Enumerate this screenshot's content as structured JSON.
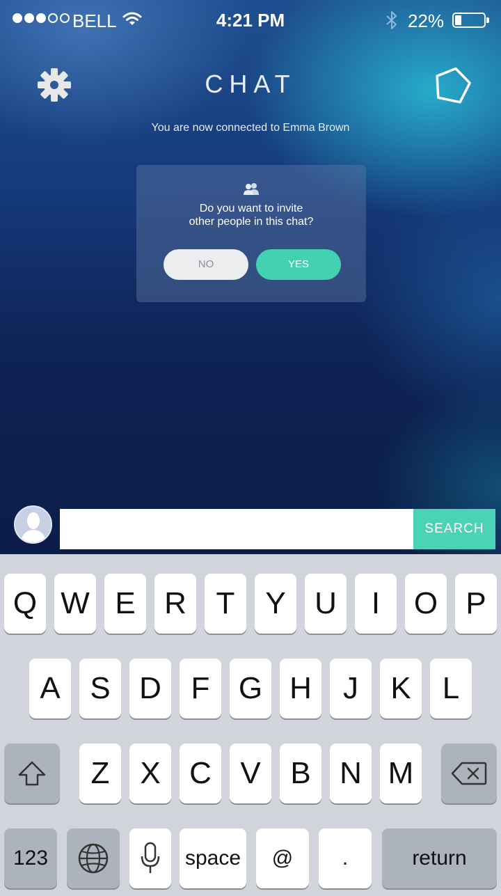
{
  "status_bar": {
    "carrier": "BELL",
    "time": "4:21 PM",
    "battery": "22%",
    "battery_level": 0.22,
    "signal_bars_filled": 3,
    "signal_bars_total": 5
  },
  "header": {
    "title": "CHAT",
    "left_icon": "gear-icon",
    "right_icon": "pentagon-icon"
  },
  "connection_message": "You are now connected to Emma Brown",
  "invite_dialog": {
    "icon": "people-icon",
    "question_line1": "Do you want to invite",
    "question_line2": "other people in this chat?",
    "no_label": "NO",
    "yes_label": "YES"
  },
  "composer": {
    "input_value": "",
    "search_label": "SEARCH"
  },
  "keyboard": {
    "row1": [
      "Q",
      "W",
      "E",
      "R",
      "T",
      "Y",
      "U",
      "I",
      "O",
      "P"
    ],
    "row2": [
      "A",
      "S",
      "D",
      "F",
      "G",
      "H",
      "J",
      "K",
      "L"
    ],
    "row3": [
      "Z",
      "X",
      "C",
      "V",
      "B",
      "N",
      "M"
    ],
    "numbers_label": "123",
    "space_label": "space",
    "at_label": "@",
    "period_label": ".",
    "return_label": "return"
  },
  "colors": {
    "accent": "#42d2b2",
    "background_top": "#1f4f90",
    "background_bottom": "#0b1c48",
    "keyboard_bg": "#d1d4da"
  }
}
